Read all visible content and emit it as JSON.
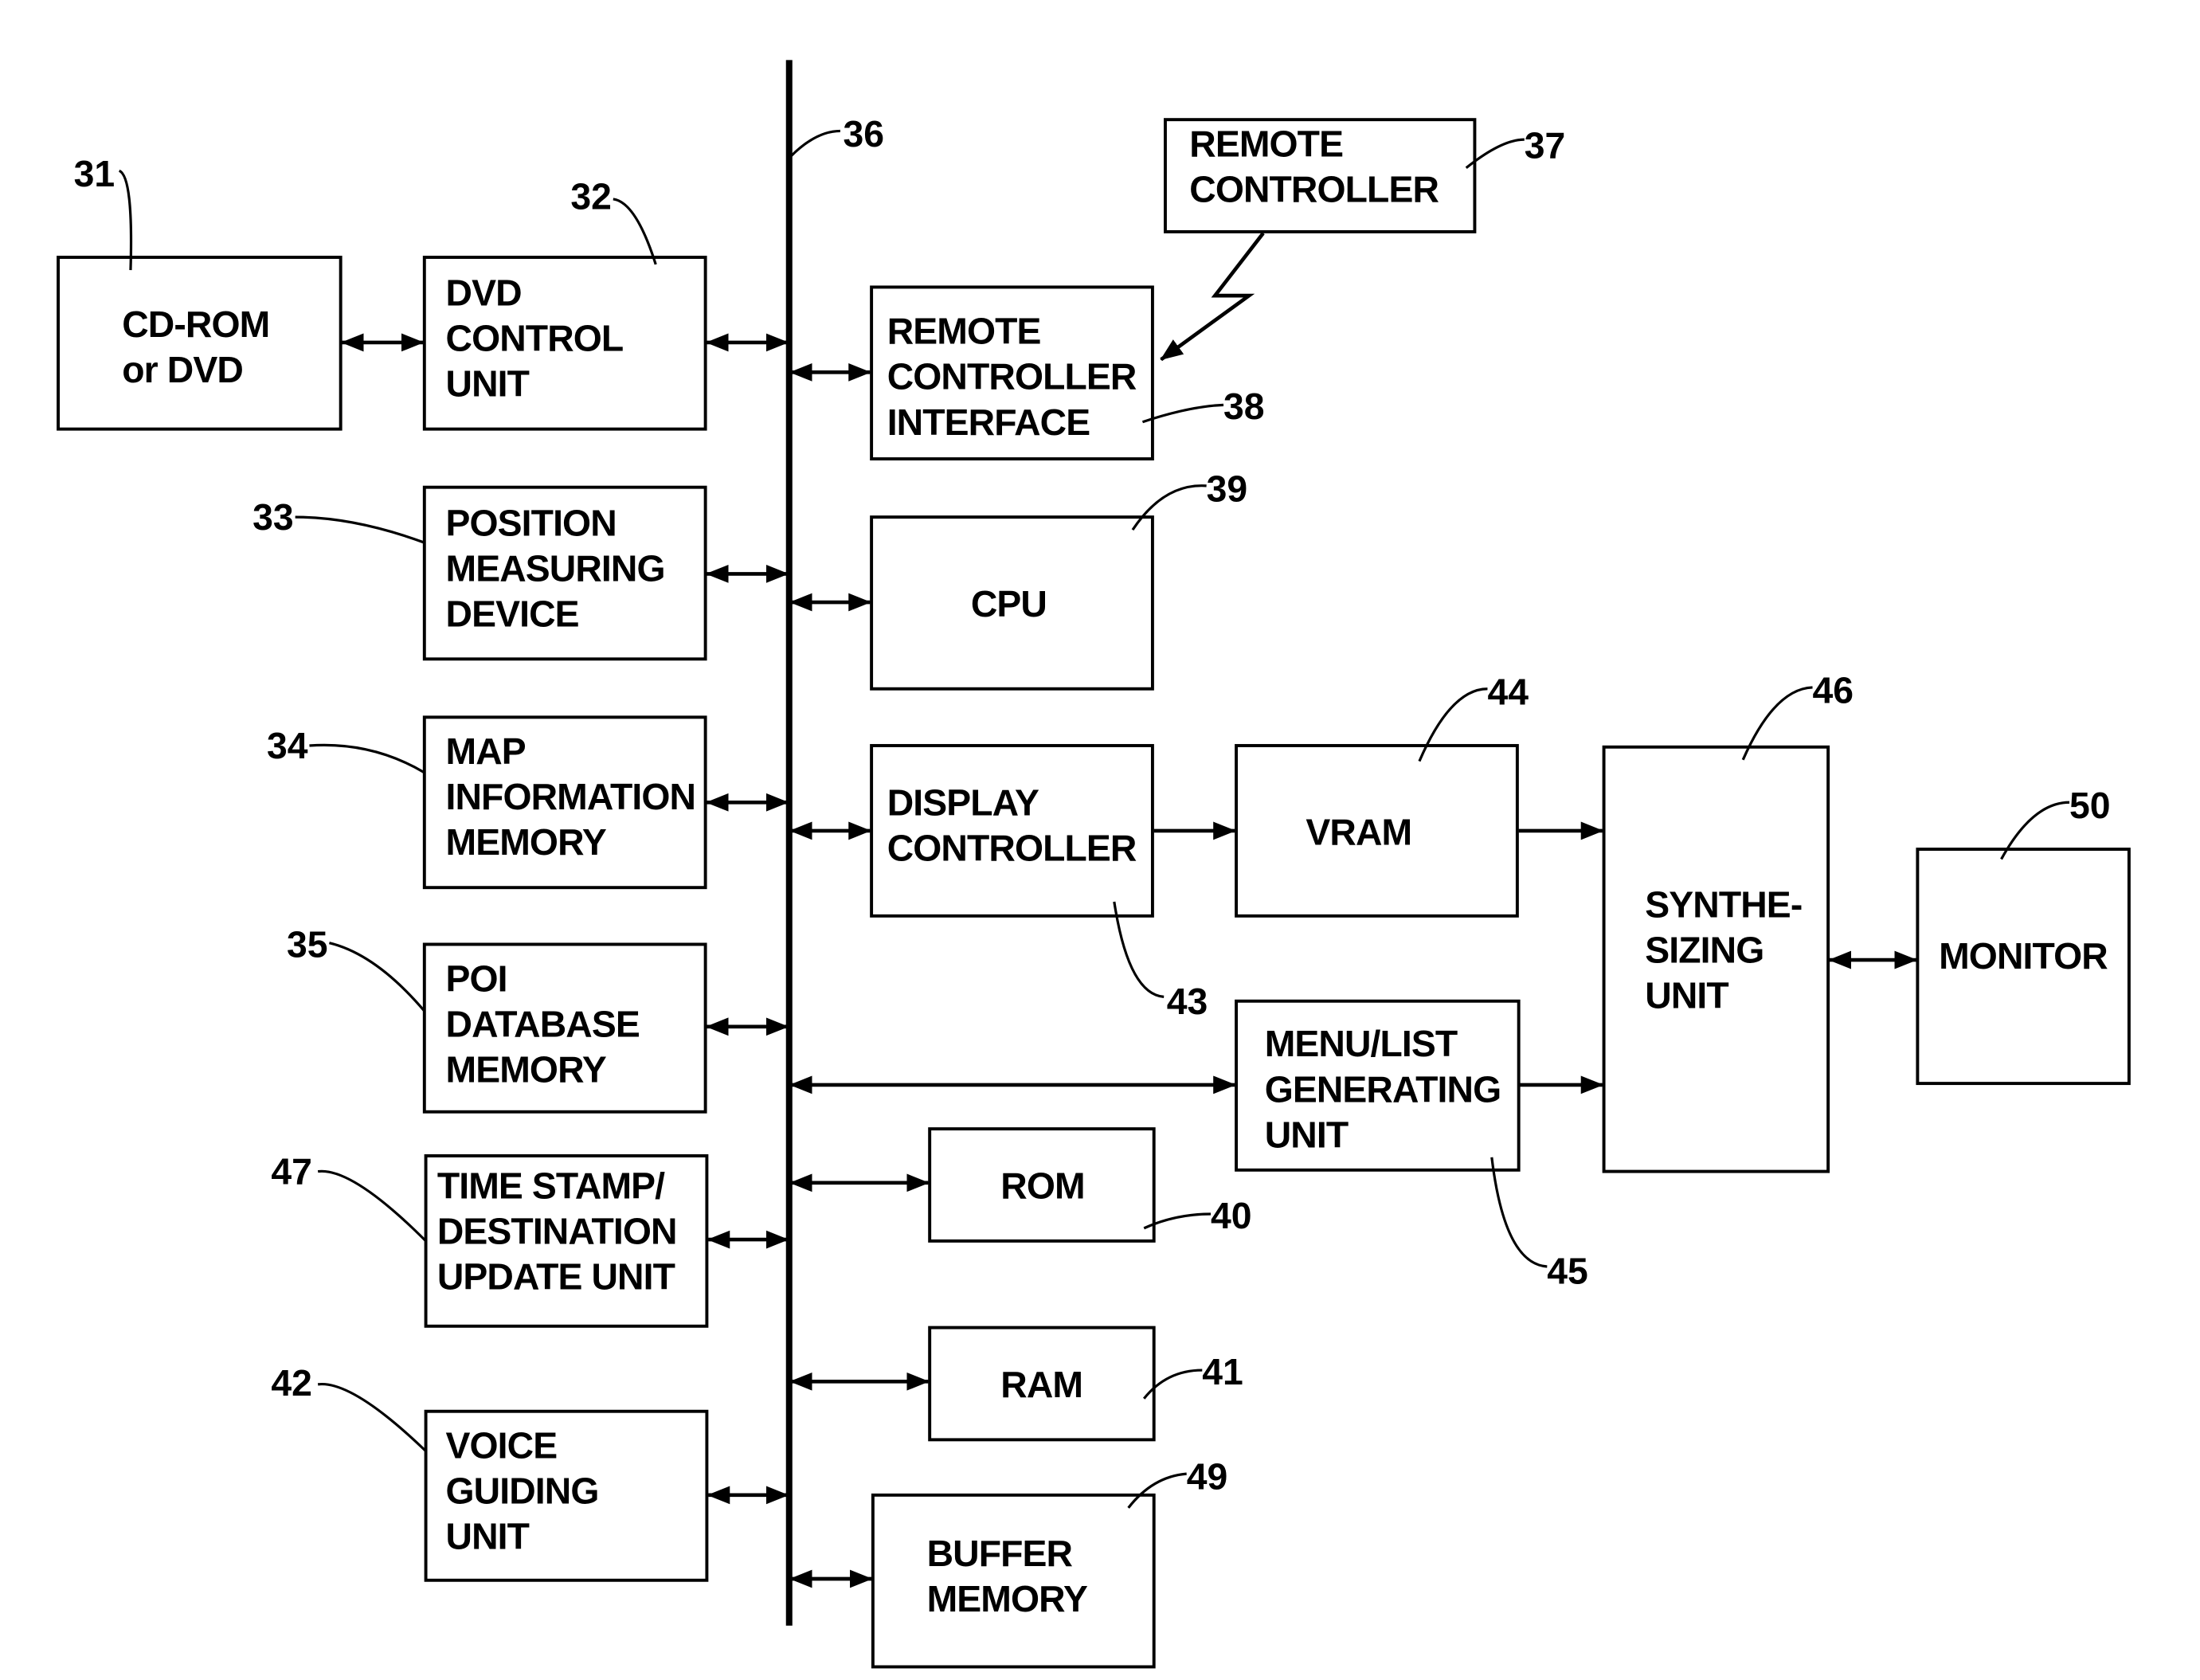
{
  "figure": {
    "bus_ref": "36",
    "blocks": [
      {
        "id": "cdrom",
        "ref": "31",
        "lines": [
          "CD-ROM",
          "or DVD"
        ]
      },
      {
        "id": "dvd_control",
        "ref": "32",
        "lines": [
          "DVD",
          "CONTROL",
          "UNIT"
        ]
      },
      {
        "id": "position",
        "ref": "33",
        "lines": [
          "POSITION",
          "MEASURING",
          "DEVICE"
        ]
      },
      {
        "id": "map_info",
        "ref": "34",
        "lines": [
          "MAP",
          "INFORMATION",
          "MEMORY"
        ]
      },
      {
        "id": "poi",
        "ref": "35",
        "lines": [
          "POI",
          "DATABASE",
          "MEMORY"
        ]
      },
      {
        "id": "timestamp",
        "ref": "47",
        "lines": [
          "TIME STAMP/",
          "DESTINATION",
          "UPDATE UNIT"
        ]
      },
      {
        "id": "voice",
        "ref": "42",
        "lines": [
          "VOICE",
          "GUIDING",
          "UNIT"
        ]
      },
      {
        "id": "remote",
        "ref": "37",
        "lines": [
          "REMOTE",
          "CONTROLLER"
        ]
      },
      {
        "id": "remote_if",
        "ref": "38",
        "lines": [
          "REMOTE",
          "CONTROLLER",
          "INTERFACE"
        ]
      },
      {
        "id": "cpu",
        "ref": "39",
        "lines": [
          "CPU"
        ]
      },
      {
        "id": "display_ctrl",
        "ref": "43",
        "lines": [
          "DISPLAY",
          "CONTROLLER"
        ]
      },
      {
        "id": "vram",
        "ref": "44",
        "lines": [
          "VRAM"
        ]
      },
      {
        "id": "synth",
        "ref": "46",
        "lines": [
          "SYNTHE-",
          "SIZING",
          "UNIT"
        ]
      },
      {
        "id": "monitor",
        "ref": "50",
        "lines": [
          "MONITOR"
        ]
      },
      {
        "id": "menu",
        "ref": "45",
        "lines": [
          "MENU/LIST",
          "GENERATING",
          "UNIT"
        ]
      },
      {
        "id": "rom",
        "ref": "40",
        "lines": [
          "ROM"
        ]
      },
      {
        "id": "ram",
        "ref": "41",
        "lines": [
          "RAM"
        ]
      },
      {
        "id": "buffer",
        "ref": "49",
        "lines": [
          "BUFFER",
          "MEMORY"
        ]
      }
    ]
  }
}
